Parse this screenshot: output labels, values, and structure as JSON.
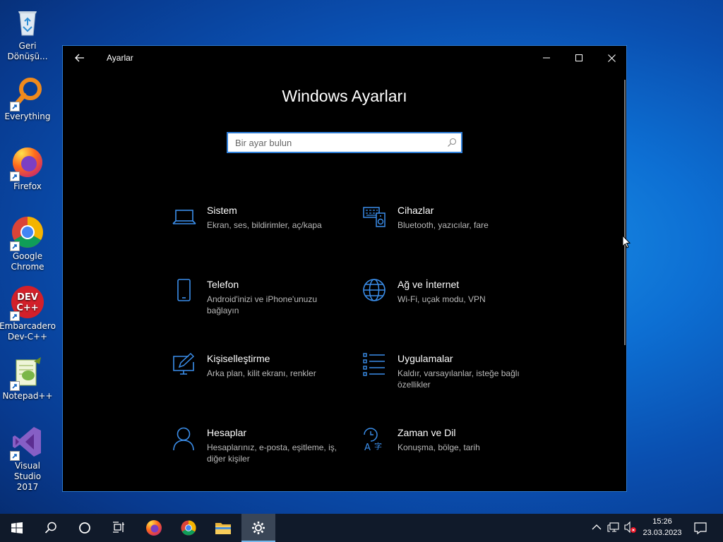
{
  "desktop": {
    "icons": [
      {
        "label": "Geri\nDönüşü...",
        "icon": "recycle-bin-icon"
      },
      {
        "label": "Everything",
        "icon": "everything-search-icon"
      },
      {
        "label": "Firefox",
        "icon": "firefox-icon"
      },
      {
        "label": "Google\nChrome",
        "icon": "chrome-icon"
      },
      {
        "label": "Embarcadero\nDev-C++",
        "icon": "devcpp-icon"
      },
      {
        "label": "Notepad++",
        "icon": "notepadpp-icon"
      },
      {
        "label": "Visual Studio\n2017",
        "icon": "visual-studio-icon"
      }
    ]
  },
  "window": {
    "title": "Ayarlar",
    "heading": "Windows Ayarları",
    "search": {
      "placeholder": "Bir ayar bulun"
    },
    "accent": "#2f7fd9",
    "tiles": [
      {
        "name": "Sistem",
        "desc": "Ekran, ses, bildirimler, aç/kapa",
        "icon": "laptop-icon"
      },
      {
        "name": "Cihazlar",
        "desc": "Bluetooth, yazıcılar, fare",
        "icon": "devices-icon"
      },
      {
        "name": "Telefon",
        "desc": "Android'inizi ve iPhone'unuzu bağlayın",
        "icon": "phone-icon"
      },
      {
        "name": "Ağ ve İnternet",
        "desc": "Wi-Fi, uçak modu, VPN",
        "icon": "globe-icon"
      },
      {
        "name": "Kişiselleştirme",
        "desc": "Arka plan, kilit ekranı, renkler",
        "icon": "personalization-icon"
      },
      {
        "name": "Uygulamalar",
        "desc": "Kaldır, varsayılanlar, isteğe bağlı özellikler",
        "icon": "apps-list-icon"
      },
      {
        "name": "Hesaplar",
        "desc": "Hesaplarınız, e-posta, eşitleme, iş, diğer kişiler",
        "icon": "person-icon"
      },
      {
        "name": "Zaman ve Dil",
        "desc": "Konuşma, bölge, tarih",
        "icon": "time-language-icon"
      }
    ]
  },
  "taskbar": {
    "clock": {
      "time": "15:26",
      "date": "23.03.2023"
    },
    "apps": [
      "start-icon",
      "search-icon",
      "cortana-icon",
      "task-view-icon",
      "firefox-icon",
      "chrome-icon",
      "file-explorer-icon",
      "settings-icon"
    ]
  }
}
